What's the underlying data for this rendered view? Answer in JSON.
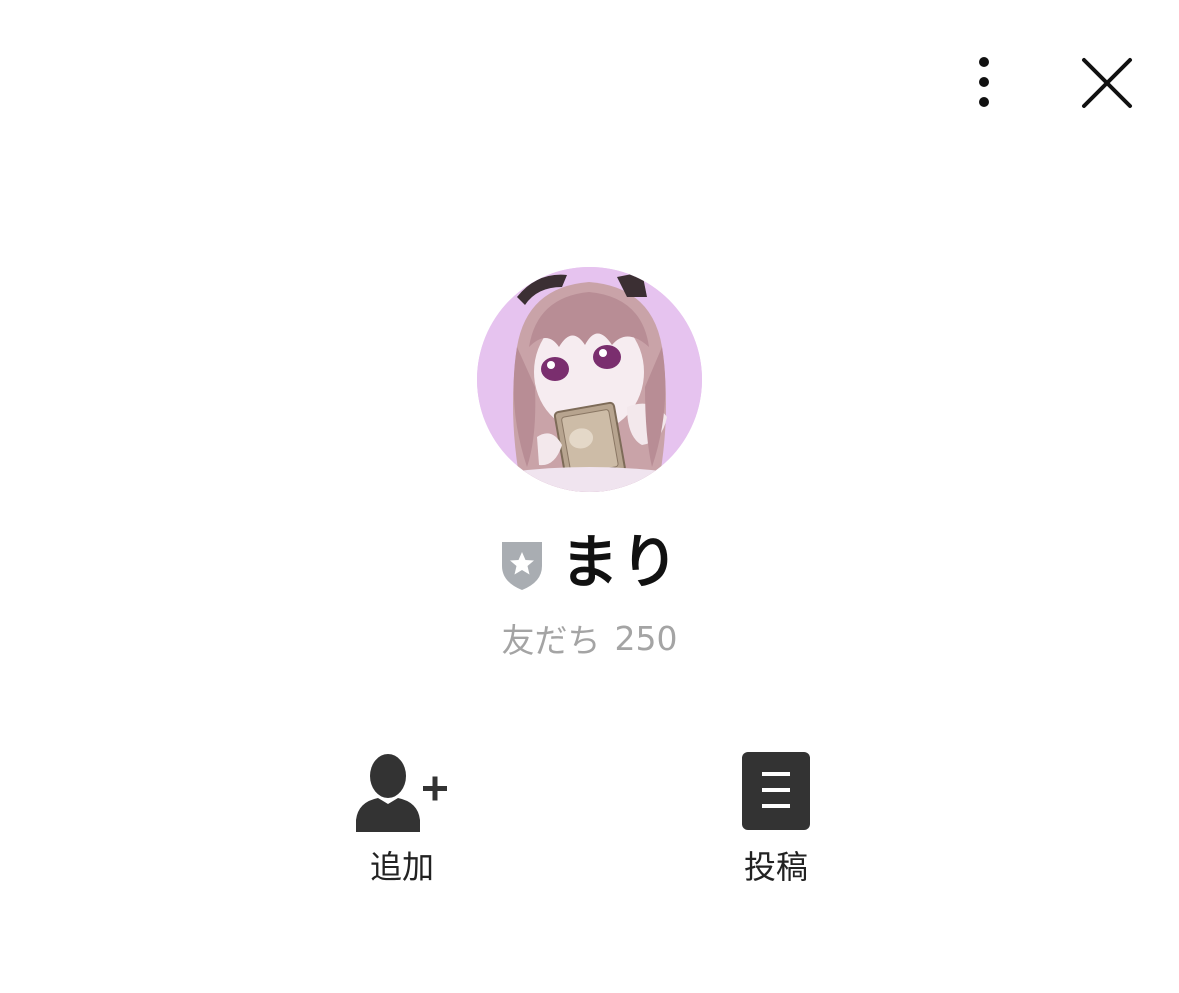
{
  "header": {
    "more_icon": "more-vertical-icon",
    "close_icon": "close-icon"
  },
  "profile": {
    "avatar_icon": "profile-avatar",
    "badge_icon": "shield-star-icon",
    "name": "まり",
    "friends_label": "友だち",
    "friends_count": "250"
  },
  "actions": [
    {
      "label": "追加",
      "icon": "add-friend-icon"
    },
    {
      "label": "投稿",
      "icon": "post-icon"
    }
  ],
  "colors": {
    "text_primary": "#111111",
    "text_secondary": "#a4a4a4",
    "icon_dark": "#333333",
    "badge_gray": "#a9adb2",
    "avatar_bg": "#e8c6f0"
  }
}
